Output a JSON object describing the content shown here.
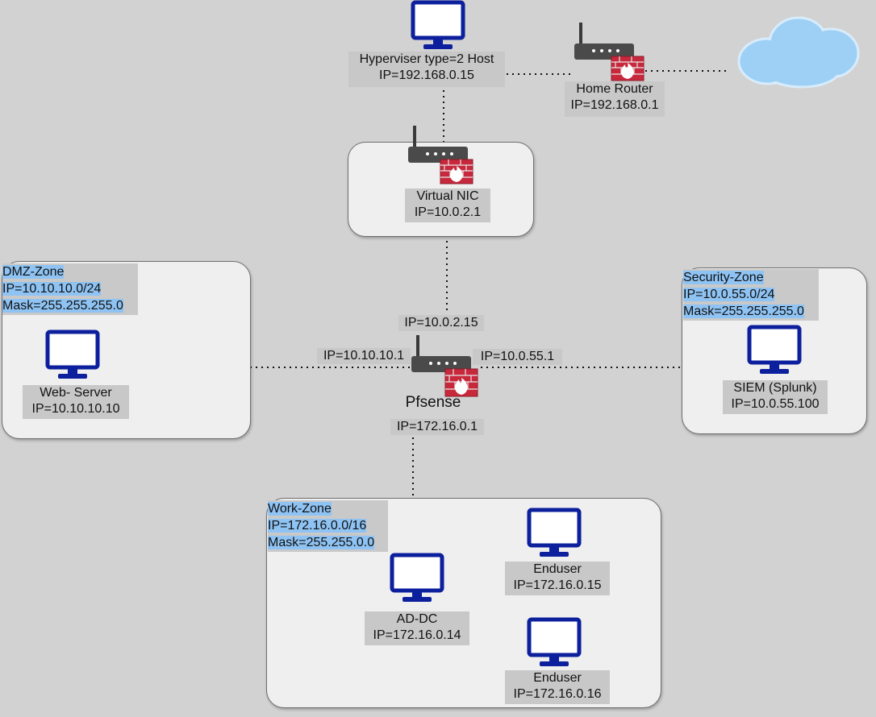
{
  "hypervisor": {
    "line1": "Hyperviser type=2 Host",
    "line2": "IP=192.168.0.15"
  },
  "home_router": {
    "line1": "Home Router",
    "line2": "IP=192.168.0.1"
  },
  "virtual_nic": {
    "line1": "Virtual NIC",
    "line2": "IP=10.0.2.1"
  },
  "pfsense": {
    "name": "Pfsense",
    "wan_ip": "IP=10.0.2.15",
    "dmz_ip": "IP=10.10.10.1",
    "security_ip": "IP=10.0.55.1",
    "work_ip": "IP=172.16.0.1"
  },
  "dmz_zone": {
    "title": "DMZ-Zone",
    "subnet": "IP=10.10.10.0/24",
    "mask": "Mask=255.255.255.0",
    "web_server": {
      "line1": "Web- Server",
      "line2": "IP=10.10.10.10"
    }
  },
  "security_zone": {
    "title": "Security-Zone",
    "subnet": "IP=10.0.55.0/24",
    "mask": "Mask=255.255.255.0",
    "siem": {
      "line1": "SIEM (Splunk)",
      "line2": "IP=10.0.55.100"
    }
  },
  "work_zone": {
    "title": "Work-Zone",
    "subnet": "IP=172.16.0.0/16",
    "mask": "Mask=255.255.0.0",
    "ad_dc": {
      "line1": "AD-DC",
      "line2": "IP=172.16.0.14"
    },
    "enduser1": {
      "line1": "Enduser",
      "line2": "IP=172.16.0.15"
    },
    "enduser2": {
      "line1": "Enduser",
      "line2": "IP=172.16.0.16"
    }
  },
  "colors": {
    "monitor": "#0c1f9c",
    "router": "#4a4a4a",
    "firewall_brick": "#c8283c",
    "highlight": "#8ec3f3",
    "cloud": "#8cc8f5"
  },
  "icons": [
    "monitor-icon",
    "router-icon",
    "firewall-icon",
    "cloud-icon"
  ]
}
